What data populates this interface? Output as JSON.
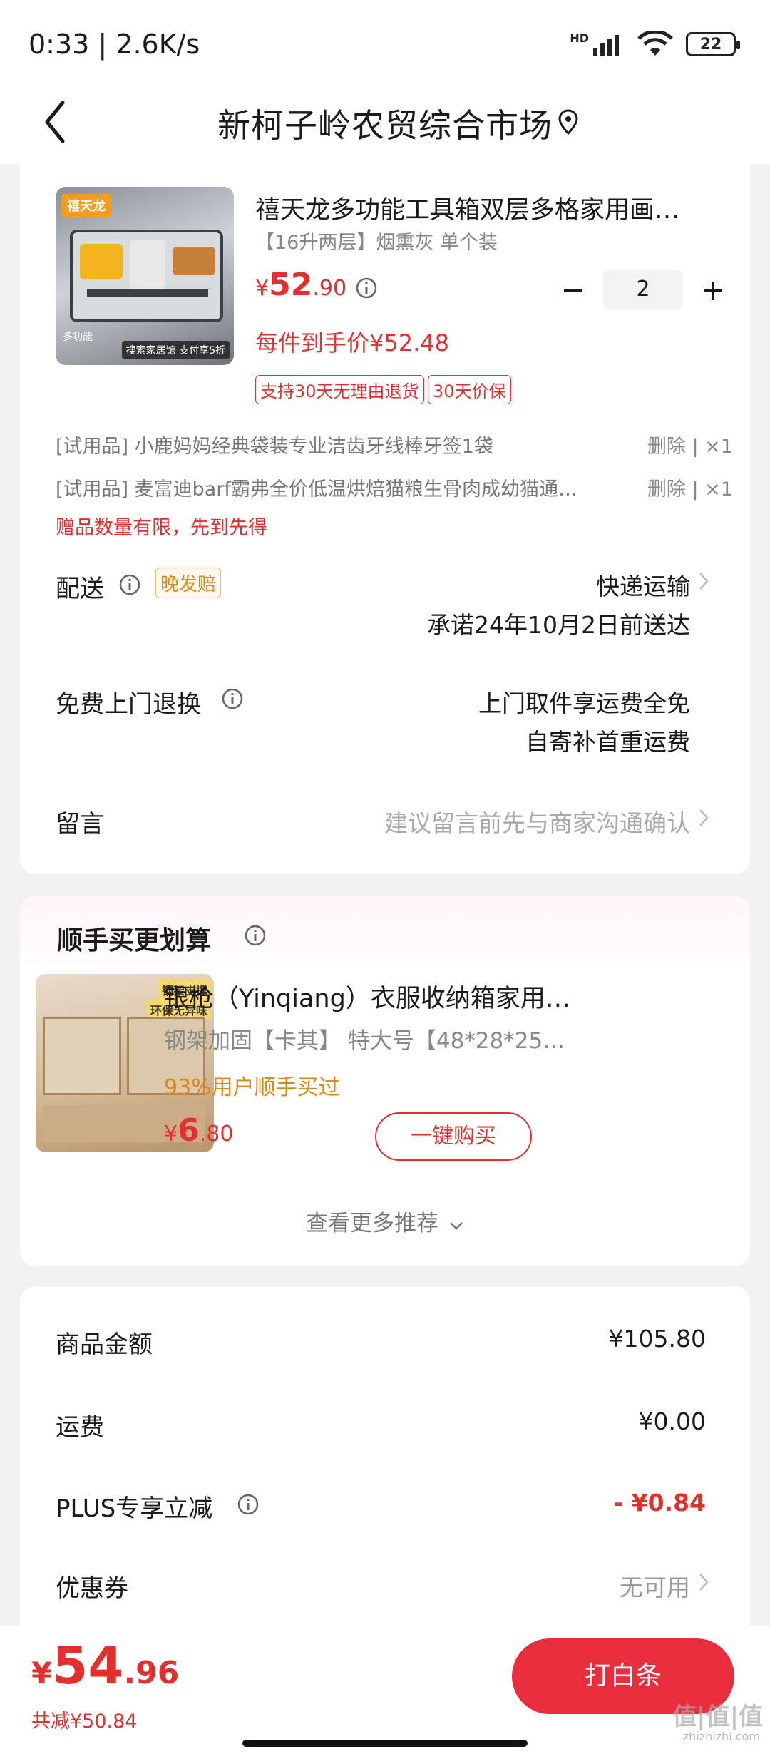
{
  "status": {
    "time": "0:33 | 2.6K/s",
    "battery": "22",
    "net_label": "HD"
  },
  "header": {
    "title": "新柯子岭农贸综合市场"
  },
  "product": {
    "thumb_brand": "禧天龙",
    "thumb_tag": "多功能",
    "thumb_banner": "搜索家居馆 支付享5折",
    "title": "禧天龙多功能工具箱双层多格家用画…",
    "spec": "【16升两层】烟熏灰 单个装",
    "price": {
      "currency": "¥",
      "integer": "52",
      "decimal": ".90"
    },
    "quantity": "2",
    "final_price": "每件到手价¥52.48",
    "tags": [
      "支持30天无理由退货",
      "30天价保"
    ],
    "gifts": [
      {
        "label": "[试用品]  小鹿妈妈经典袋装专业洁齿牙线棒牙签1袋",
        "action": "删除 | ×1"
      },
      {
        "label": "[试用品]  麦富迪barf霸弗全价低温烘焙猫粮生骨肉成幼猫通…",
        "action": "删除 | ×1"
      }
    ],
    "gift_note": "赠品数量有限，先到先得"
  },
  "delivery": {
    "label": "配送",
    "badge": "晚发赔",
    "method": "快递运输",
    "promise": "承诺24年10月2日前送达"
  },
  "returns": {
    "label": "免费上门退换",
    "line1": "上门取件享运费全免",
    "line2": "自寄补首重运费"
  },
  "message": {
    "label": "留言",
    "placeholder": "建议留言前先与商家沟通确认"
  },
  "upsell": {
    "title": "顺手买更划算",
    "thumb_badge1": "钢架支撑",
    "thumb_badge2": "环保无异味",
    "product_title": "银枪（Yinqiang）衣服收纳箱家用…",
    "spec": "钢架加固【卡其】   特大号【48*28*25…",
    "social": "93%用户顺手买过",
    "price": {
      "currency": "¥",
      "integer": "6",
      "decimal": ".80"
    },
    "buy_label": "一键购买",
    "more": "查看更多推荐"
  },
  "summary": {
    "rows": [
      {
        "label": "商品金额",
        "value": "¥105.80"
      },
      {
        "label": "运费",
        "value": "¥0.00"
      },
      {
        "label": "PLUS专享立减",
        "value": "- ¥0.84"
      },
      {
        "label": "优惠券",
        "value": "无可用"
      }
    ]
  },
  "footer": {
    "total": {
      "currency": "¥",
      "integer": "54",
      "decimal": ".96"
    },
    "saved": "共减¥50.84",
    "pay_label": "打白条"
  },
  "watermark": {
    "main": "值|值|值",
    "sub": "zhizhizhi.com"
  },
  "colors": {
    "accent": "#e52f2f",
    "orange": "#d98a1a",
    "bg": "#f2f2f2"
  }
}
